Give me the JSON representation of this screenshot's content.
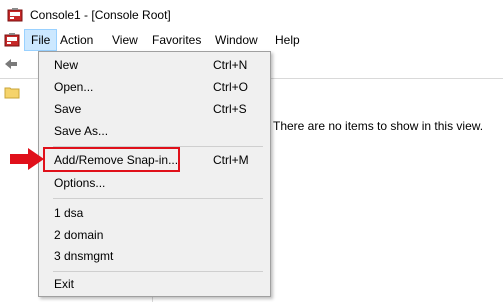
{
  "window": {
    "title": "Console1 - [Console Root]"
  },
  "menubar": {
    "items": [
      "File",
      "Action",
      "View",
      "Favorites",
      "Window",
      "Help"
    ]
  },
  "right_pane": {
    "empty_message": "There are no items to show in this view."
  },
  "file_menu": {
    "items": [
      {
        "label": "New",
        "shortcut": "Ctrl+N"
      },
      {
        "label": "Open...",
        "shortcut": "Ctrl+O"
      },
      {
        "label": "Save",
        "shortcut": "Ctrl+S"
      },
      {
        "label": "Save As...",
        "shortcut": ""
      },
      {
        "label": "Add/Remove Snap-in...",
        "shortcut": "Ctrl+M"
      },
      {
        "label": "Options...",
        "shortcut": ""
      },
      {
        "label": "1 dsa",
        "shortcut": ""
      },
      {
        "label": "2 domain",
        "shortcut": ""
      },
      {
        "label": "3 dnsmgmt",
        "shortcut": ""
      },
      {
        "label": "Exit",
        "shortcut": ""
      }
    ]
  },
  "colors": {
    "highlight": "#e0101a",
    "menu_active": "#cce8ff",
    "menu_bg": "#f0f0f0"
  }
}
